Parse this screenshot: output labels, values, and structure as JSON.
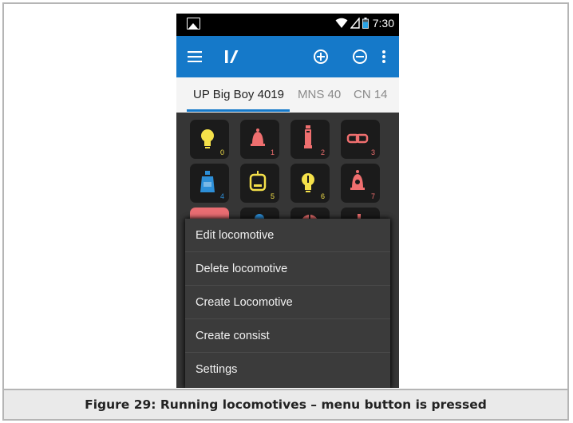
{
  "status_bar": {
    "time": "7:30"
  },
  "action_bar": {
    "menu_icon": "hamburger-icon",
    "logo_icon": "throttle-logo-icon",
    "add_icon": "plus-circle-icon",
    "remove_icon": "minus-circle-icon",
    "overflow_icon": "more-vert-icon"
  },
  "tabs": [
    {
      "label": "UP Big Boy 4019",
      "active": true
    },
    {
      "label": "MNS 40",
      "active": false
    },
    {
      "label": "CN 14",
      "active": false
    }
  ],
  "functions": [
    {
      "number": "0",
      "icon": "light-bulb-icon",
      "color": "#f5e14a"
    },
    {
      "number": "1",
      "icon": "bell-icon",
      "color": "#ef6f6f"
    },
    {
      "number": "2",
      "icon": "horn-icon",
      "color": "#ef6f6f"
    },
    {
      "number": "3",
      "icon": "coupler-icon",
      "color": "#ef6f6f"
    },
    {
      "number": "4",
      "icon": "oil-can-icon",
      "color": "#2d8fd8"
    },
    {
      "number": "5",
      "icon": "cab-light-icon",
      "color": "#f5e14a"
    },
    {
      "number": "6",
      "icon": "light-bulb-one-icon",
      "color": "#f5e14a"
    },
    {
      "number": "7",
      "icon": "bell-sound-icon",
      "color": "#ef6f6f"
    }
  ],
  "menu": {
    "items": [
      "Edit locomotive",
      "Delete locomotive",
      "Create Locomotive",
      "Create consist",
      "Settings"
    ]
  },
  "caption": "Figure 29: Running locomotives – menu button is pressed",
  "colors": {
    "action_bar": "#1579c9",
    "status_bar": "#000000",
    "menu_background": "#3b3b3b",
    "function_background": "#1b1b1b"
  }
}
